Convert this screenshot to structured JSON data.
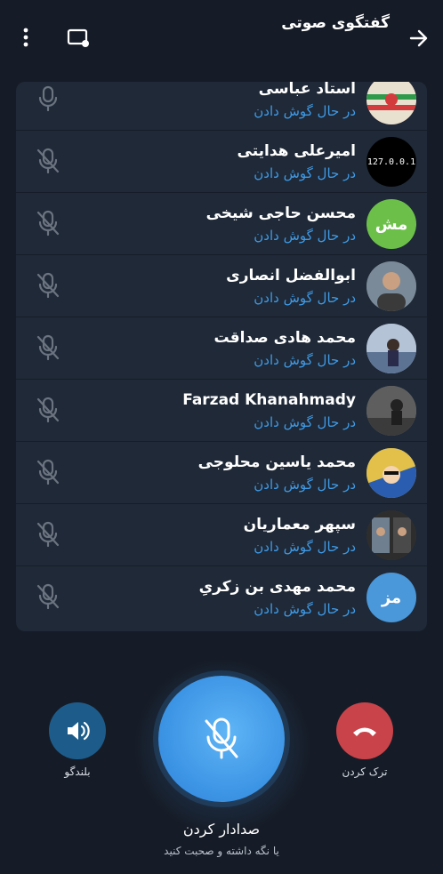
{
  "header": {
    "title": "گفتگوی صوتی"
  },
  "participants": [
    {
      "name": "استاد عباسی",
      "status": "در حال گوش دادن",
      "avatar_text": "",
      "avatar_color": "#c9553f"
    },
    {
      "name": "امیرعلی هدایتی",
      "status": "در حال گوش دادن",
      "avatar_text": "127.0.0.1",
      "avatar_color": "#000000"
    },
    {
      "name": "محسن حاجی شیخی",
      "status": "در حال گوش دادن",
      "avatar_text": "مش",
      "avatar_color": "#6cc04a"
    },
    {
      "name": "ابوالفضل انصاری",
      "status": "در حال گوش دادن",
      "avatar_text": "",
      "avatar_color": "#5a6a7a"
    },
    {
      "name": "محمد هادی صداقت",
      "status": "در حال گوش دادن",
      "avatar_text": "",
      "avatar_color": "#8aa4c2"
    },
    {
      "name": "Farzad Khanahmady",
      "status": "در حال گوش دادن",
      "avatar_text": "",
      "avatar_color": "#6e6e6e"
    },
    {
      "name": "محمد یاسین محلوجی",
      "status": "در حال گوش دادن",
      "avatar_text": "",
      "avatar_color": "#d7b340"
    },
    {
      "name": "سپهر معماریان",
      "status": "در حال گوش دادن",
      "avatar_text": "",
      "avatar_color": "#3d3d3d"
    },
    {
      "name": "محمد مهدی بن زکریِ",
      "status": "در حال گوش دادن",
      "avatar_text": "مز",
      "avatar_color": "#4a97d9"
    }
  ],
  "controls": {
    "speaker_label": "بلندگو",
    "leave_label": "ترک کردن",
    "unmute_label": "صدادار کردن",
    "hint_label": "یا نگه داشته و صحبت کنید"
  },
  "colors": {
    "background": "#161c27",
    "panel": "#1f2937",
    "accent": "#3e96e6",
    "leave": "#c9434a",
    "speaker": "#1d5c8a"
  }
}
